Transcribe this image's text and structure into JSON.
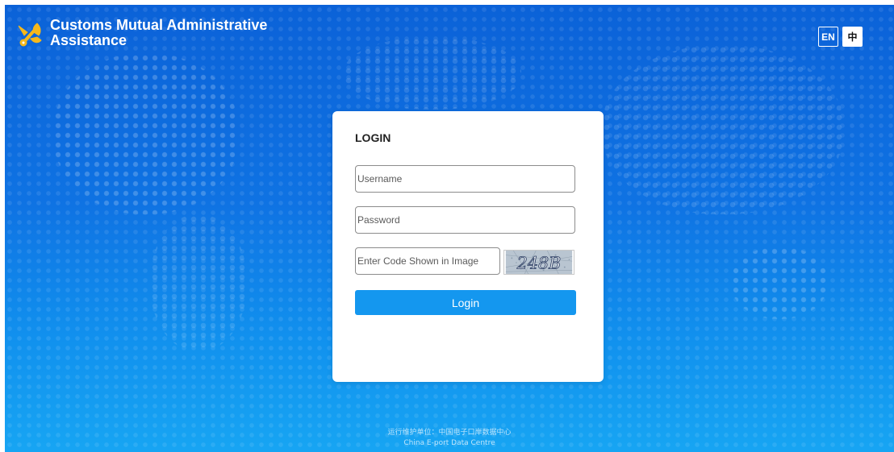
{
  "header": {
    "title": "Customs Mutual Administrative Assistance",
    "logo_icon": "customs-emblem-icon"
  },
  "language": {
    "en_label": "EN",
    "zh_label": "中"
  },
  "login": {
    "heading": "LOGIN",
    "username_placeholder": "Username",
    "password_placeholder": "Password",
    "code_placeholder": "Enter Code Shown in Image",
    "captcha_text": "248B",
    "button_label": "Login"
  },
  "footer": {
    "operator_cn": "运行维护单位：中国电子口岸数据中心",
    "operator_en": "China E-port Data Centre"
  },
  "colors": {
    "background": "#0f73e3",
    "button": "#1497ef",
    "card": "#ffffff"
  }
}
